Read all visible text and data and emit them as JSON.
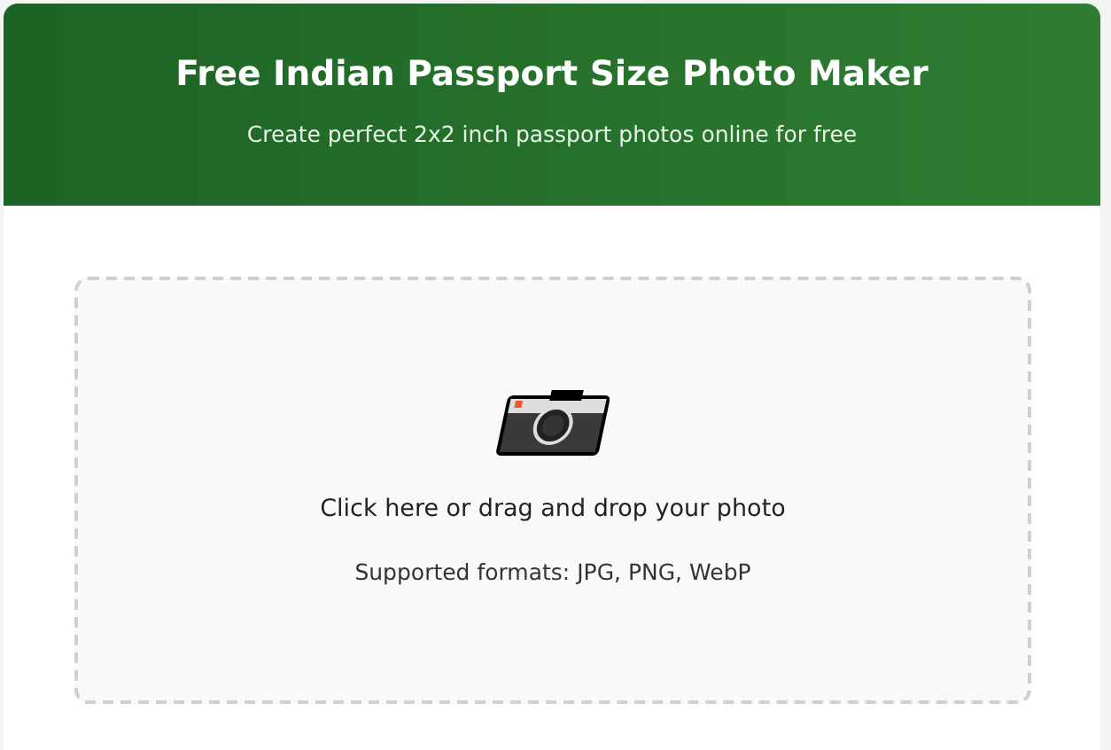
{
  "header": {
    "title": "Free Indian Passport Size Photo Maker",
    "subtitle": "Create perfect 2x2 inch passport photos online for free"
  },
  "upload": {
    "prompt": "Click here or drag and drop your photo",
    "formats": "Supported formats: JPG, PNG, WebP"
  }
}
